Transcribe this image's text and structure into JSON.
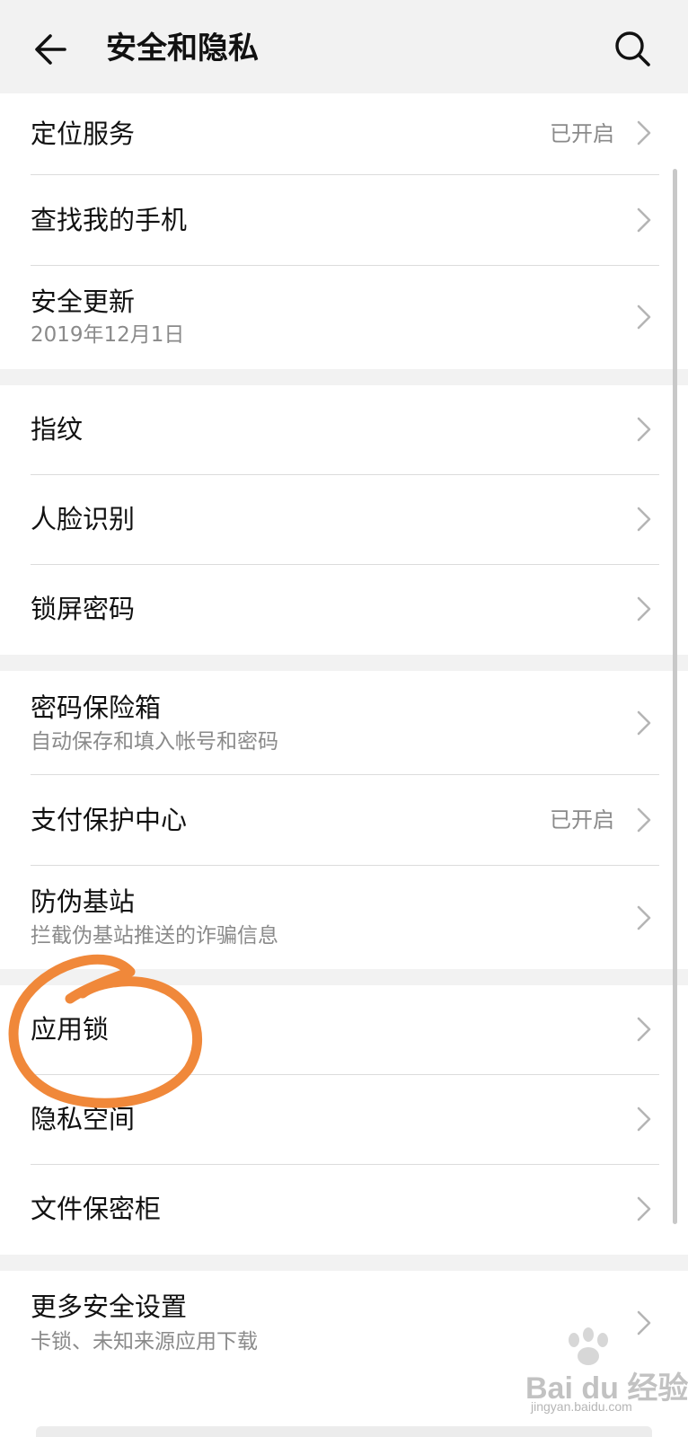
{
  "header": {
    "title": "安全和隐私",
    "back_icon": "arrow-left-icon",
    "search_icon": "search-icon"
  },
  "sections": [
    {
      "rows": [
        {
          "label": "定位服务",
          "status": "已开启"
        },
        {
          "label": "查找我的手机"
        },
        {
          "label": "安全更新",
          "sub": "2019年12月1日"
        }
      ]
    },
    {
      "rows": [
        {
          "label": "指纹"
        },
        {
          "label": "人脸识别"
        },
        {
          "label": "锁屏密码"
        }
      ]
    },
    {
      "rows": [
        {
          "label": "密码保险箱",
          "sub": "自动保存和填入帐号和密码"
        },
        {
          "label": "支付保护中心",
          "status": "已开启"
        },
        {
          "label": "防伪基站",
          "sub": "拦截伪基站推送的诈骗信息"
        }
      ]
    },
    {
      "rows": [
        {
          "label": "应用锁"
        },
        {
          "label": "隐私空间"
        },
        {
          "label": "文件保密柜"
        }
      ]
    },
    {
      "rows": [
        {
          "label": "更多安全设置",
          "sub": "卡锁、未知来源应用下载"
        }
      ]
    }
  ],
  "watermark": {
    "brand": "Bai du 经验",
    "url": "jingyan.baidu.com"
  },
  "colors": {
    "header_bg": "#f2f2f2",
    "annotation": "#f0883a",
    "secondary_text": "#8a8a8a"
  }
}
